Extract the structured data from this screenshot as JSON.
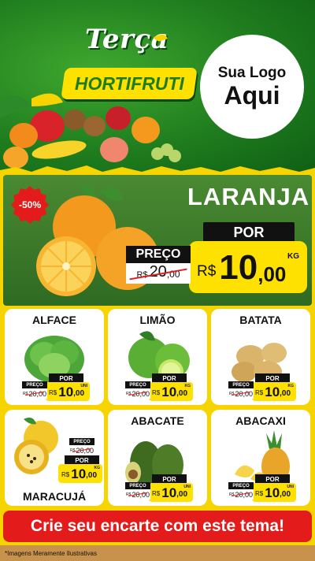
{
  "header": {
    "title_day": "Terça",
    "title_section": "HORTIFRUTI",
    "logo_line1": "Sua Logo",
    "logo_line2": "Aqui"
  },
  "featured": {
    "discount": "-50%",
    "name": "LARANJA",
    "old_label": "PREÇO",
    "old_currency": "R$",
    "old_int": "20",
    "old_dec": ",00",
    "por_label": "POR",
    "currency": "R$",
    "price_int": "10",
    "price_dec": ",00",
    "unit": "KG"
  },
  "products": [
    {
      "name": "ALFACE",
      "old_label": "PREÇO",
      "old_currency": "R$",
      "old_value": "20,00",
      "por_label": "POR",
      "currency": "R$",
      "price_int": "10",
      "price_dec": ",00",
      "unit": "UNI"
    },
    {
      "name": "LIMÃO",
      "old_label": "PREÇO",
      "old_currency": "R$",
      "old_value": "20,00",
      "por_label": "POR",
      "currency": "R$",
      "price_int": "10",
      "price_dec": ",00",
      "unit": "KG"
    },
    {
      "name": "BATATA",
      "old_label": "PREÇO",
      "old_currency": "R$",
      "old_value": "20,00",
      "por_label": "POR",
      "currency": "R$",
      "price_int": "10",
      "price_dec": ",00",
      "unit": "KG"
    },
    {
      "name": "MARACUJÁ",
      "old_label": "PREÇO",
      "old_currency": "R$",
      "old_value": "20,00",
      "por_label": "POR",
      "currency": "R$",
      "price_int": "10",
      "price_dec": ",00",
      "unit": "KG"
    },
    {
      "name": "ABACATE",
      "old_label": "PREÇO",
      "old_currency": "R$",
      "old_value": "20,00",
      "por_label": "POR",
      "currency": "R$",
      "price_int": "10",
      "price_dec": ",00",
      "unit": "UNI"
    },
    {
      "name": "ABACAXI",
      "old_label": "PREÇO",
      "old_currency": "R$",
      "old_value": "20,00",
      "por_label": "POR",
      "currency": "R$",
      "price_int": "10",
      "price_dec": ",00",
      "unit": "UNI"
    }
  ],
  "banner": "Crie seu encarte com este tema!",
  "footnote": "*Imagens Meramente Ilustrativas",
  "colors": {
    "green": "#1f7d1e",
    "yellow": "#ffe100",
    "red": "#e31b1b",
    "black": "#111111"
  }
}
